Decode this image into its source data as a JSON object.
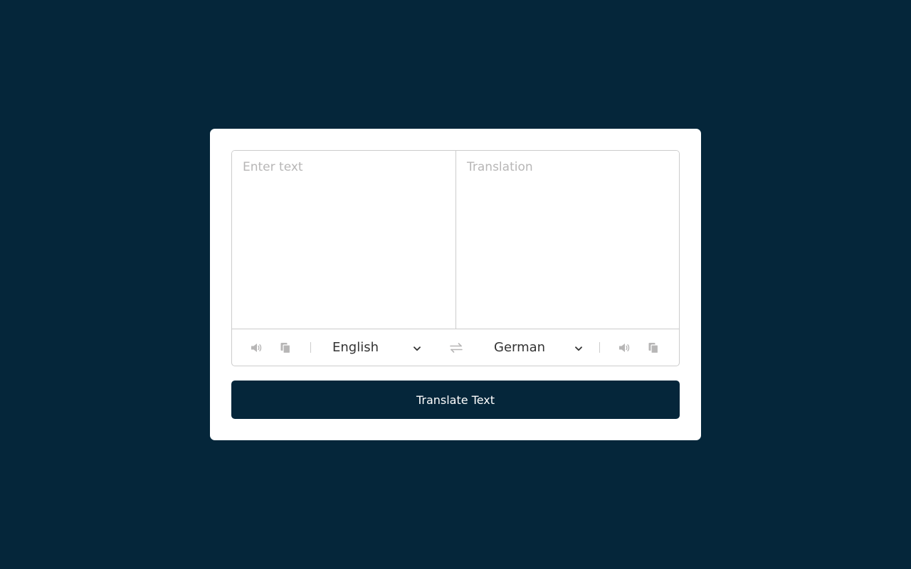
{
  "from_text": {
    "placeholder": "Enter text",
    "value": ""
  },
  "to_text": {
    "placeholder": "Translation",
    "value": ""
  },
  "controls": {
    "from_language": "English",
    "to_language": "German",
    "from_icons": [
      "speaker-icon",
      "copy-icon"
    ],
    "to_icons": [
      "speaker-icon",
      "copy-icon"
    ],
    "exchange_icon": "exchange-icon"
  },
  "button": {
    "label": "Translate Text"
  },
  "colors": {
    "background": "#05263a",
    "card": "#ffffff",
    "border": "#cccccc",
    "icon": "#b7b6b6",
    "text": "#333333",
    "button": "#05263a"
  }
}
